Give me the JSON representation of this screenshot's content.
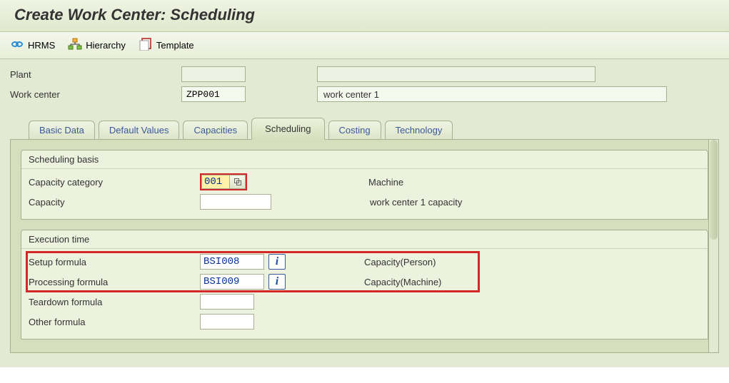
{
  "title": "Create Work Center: Scheduling",
  "toolbar": {
    "hrms": "HRMS",
    "hierarchy": "Hierarchy",
    "template": "Template"
  },
  "header": {
    "plant_label": "Plant",
    "plant_value": "",
    "plant_desc": "",
    "wc_label": "Work center",
    "wc_value": "ZPP001",
    "wc_desc": "work center 1"
  },
  "tabs": {
    "basic": "Basic Data",
    "default": "Default Values",
    "capacities": "Capacities",
    "scheduling": "Scheduling",
    "costing": "Costing",
    "technology": "Technology"
  },
  "scheduling_basis": {
    "title": "Scheduling basis",
    "capacity_category_label": "Capacity category",
    "capacity_category_value": "001",
    "capacity_category_desc": "Machine",
    "capacity_label": "Capacity",
    "capacity_value": "",
    "capacity_desc": "work center 1  capacity"
  },
  "execution_time": {
    "title": "Execution time",
    "setup_label": "Setup formula",
    "setup_value": "BSI008",
    "setup_desc": "Capacity(Person)",
    "processing_label": "Processing formula",
    "processing_value": "BSI009",
    "processing_desc": "Capacity(Machine)",
    "teardown_label": "Teardown formula",
    "teardown_value": "",
    "other_label": "Other formula",
    "other_value": "",
    "info_glyph": "i"
  }
}
